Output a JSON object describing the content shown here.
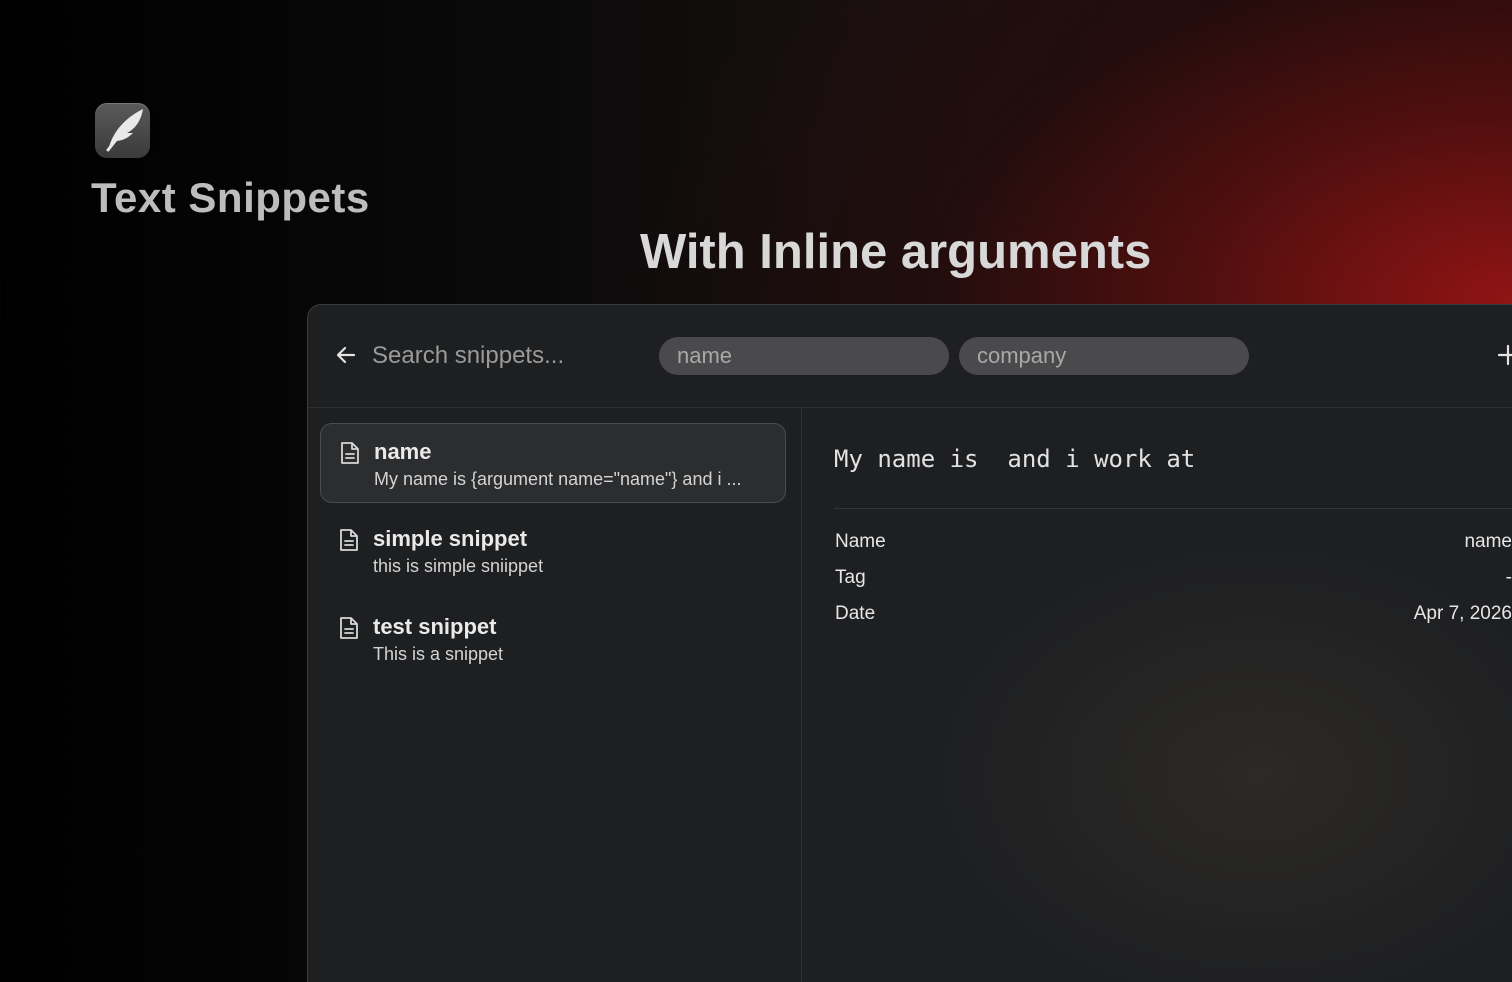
{
  "branding": {
    "app_title": "Text Snippets",
    "headline": "With Inline arguments",
    "icon": "feather-icon"
  },
  "search": {
    "placeholder": "Search snippets...",
    "value": "",
    "back_icon": "arrow-left-icon",
    "add_icon": "plus-icon"
  },
  "arguments": [
    {
      "placeholder": "name",
      "value": ""
    },
    {
      "placeholder": "company",
      "value": ""
    }
  ],
  "snippets": [
    {
      "title": "name",
      "subtitle": "My name is {argument name=\"name\"} and i ...",
      "selected": true,
      "icon": "document-icon"
    },
    {
      "title": "simple snippet",
      "subtitle": "this is simple sniippet",
      "selected": false,
      "icon": "document-icon"
    },
    {
      "title": "test snippet",
      "subtitle": "This is a snippet",
      "selected": false,
      "icon": "document-icon"
    }
  ],
  "detail": {
    "preview": "My name is  and i work at",
    "metadata": [
      {
        "label": "Name",
        "value": "name"
      },
      {
        "label": "Tag",
        "value": "-"
      },
      {
        "label": "Date",
        "value": "Apr 7, 2026"
      }
    ]
  }
}
